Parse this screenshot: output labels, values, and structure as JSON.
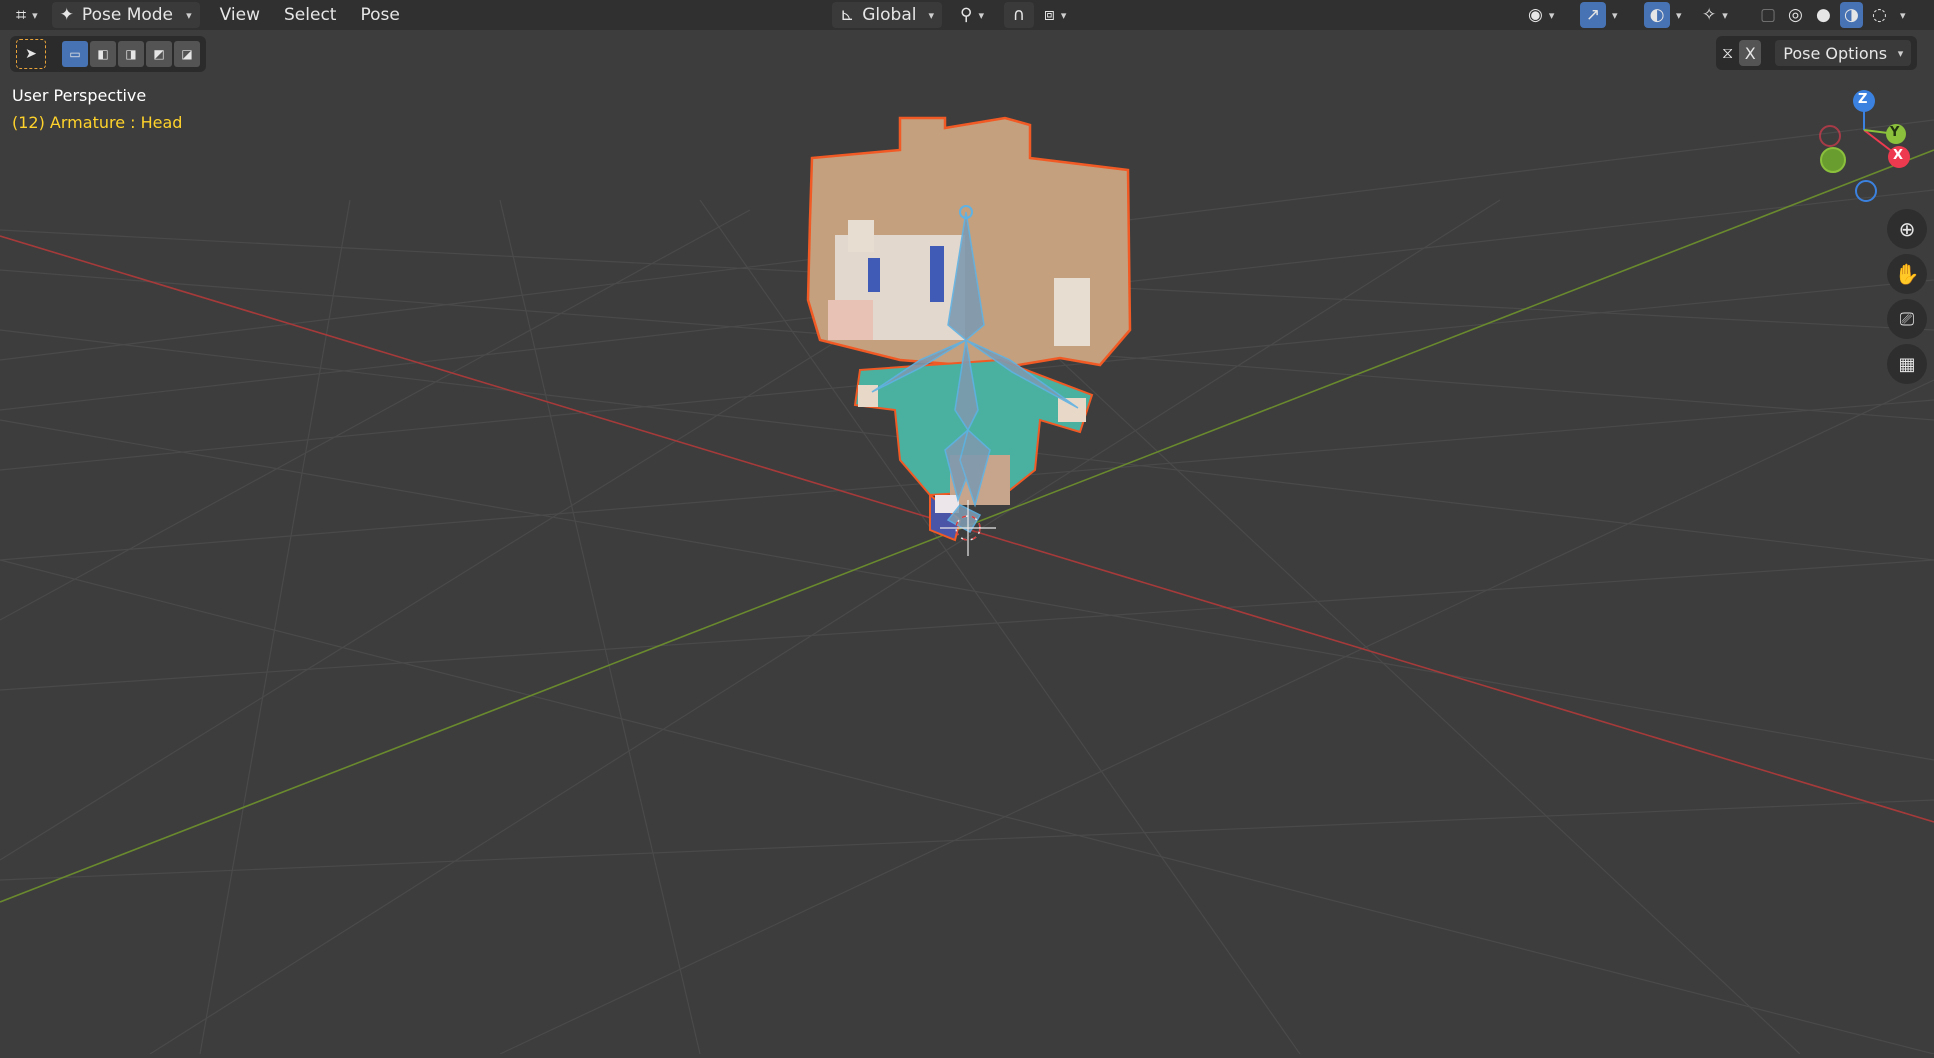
{
  "header": {
    "editor_type_icon": "3d-viewport-icon",
    "mode_label": "Pose Mode",
    "menu": [
      "View",
      "Select",
      "Pose"
    ],
    "transform_orientation": "Global"
  },
  "toolbar": {
    "tools": [
      "select-box-icon"
    ],
    "select_modes": [
      "mode-new",
      "mode-extend",
      "mode-subtract",
      "mode-invert",
      "mode-intersect"
    ]
  },
  "overlay": {
    "perspective": "User Perspective",
    "object_info": "(12) Armature : Head"
  },
  "pose_options": {
    "mirror_axis": "X",
    "label": "Pose Options"
  },
  "gizmo": {
    "x": "X",
    "y": "Y",
    "z": "Z"
  },
  "colors": {
    "accent": "#4772b3",
    "object_info": "#ffd32b",
    "x_axis": "#ee3a4f",
    "y_axis": "#8ac03c",
    "z_axis": "#3b82e0",
    "selection_outline": "#f15a24"
  }
}
